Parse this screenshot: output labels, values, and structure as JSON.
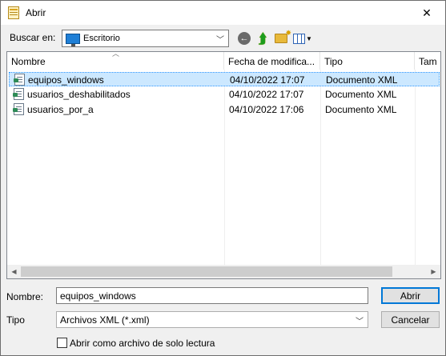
{
  "window": {
    "title": "Abrir",
    "close_glyph": "✕"
  },
  "toolbar": {
    "lookin_label": "Buscar en:",
    "lookin_value": "Escritorio",
    "icons": [
      "back-icon",
      "up-folder-icon",
      "new-folder-icon",
      "view-menu-icon"
    ]
  },
  "columns": [
    {
      "label": "Nombre"
    },
    {
      "label": "Fecha de modifica..."
    },
    {
      "label": "Tipo"
    },
    {
      "label": "Tam"
    }
  ],
  "files": [
    {
      "name": "equipos_windows",
      "date": "04/10/2022 17:07",
      "type": "Documento XML",
      "selected": true
    },
    {
      "name": "usuarios_deshabilitados",
      "date": "04/10/2022 17:07",
      "type": "Documento XML",
      "selected": false
    },
    {
      "name": "usuarios_por_a",
      "date": "04/10/2022 17:06",
      "type": "Documento XML",
      "selected": false
    }
  ],
  "bottom": {
    "name_label": "Nombre:",
    "name_value": "equipos_windows",
    "type_label": "Tipo",
    "type_value": "Archivos XML (*.xml)",
    "open_button": "Abrir",
    "cancel_button": "Cancelar",
    "readonly_label": "Abrir como archivo de solo lectura",
    "readonly_checked": false
  },
  "colors": {
    "selection_bg": "#cce8ff",
    "selection_border": "#3399ff",
    "accent": "#0078d7"
  }
}
